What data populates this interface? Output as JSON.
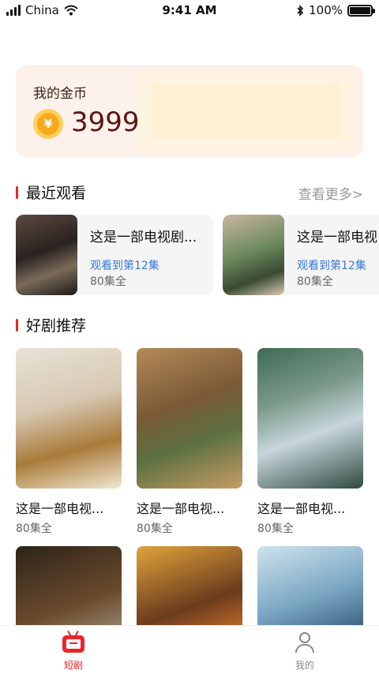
{
  "status_bar": {
    "carrier": "China",
    "time": "9:41 AM",
    "battery": "100%",
    "battery_level": 1.0
  },
  "coin": {
    "title": "我的金币",
    "symbol": "¥",
    "value": "3999"
  },
  "recent": {
    "title": "最近观看",
    "more": "查看更多>",
    "items": [
      {
        "name": "这是一部电视剧...",
        "progress": "观看到第12集",
        "total": "80集全"
      },
      {
        "name": "这是一部电视",
        "progress": "观看到第12集",
        "total": "80集全"
      }
    ]
  },
  "recommend": {
    "title": "好剧推荐",
    "items": [
      {
        "name": "这是一部电视...",
        "total": "80集全"
      },
      {
        "name": "这是一部电视...",
        "total": "80集全"
      },
      {
        "name": "这是一部电视...",
        "total": "80集全"
      }
    ]
  },
  "tabbar": {
    "tabs": [
      {
        "label": "短剧",
        "active": true
      },
      {
        "label": "我的",
        "active": false
      }
    ],
    "colors": {
      "active": "#e8262a",
      "inactive": "#888888"
    }
  }
}
